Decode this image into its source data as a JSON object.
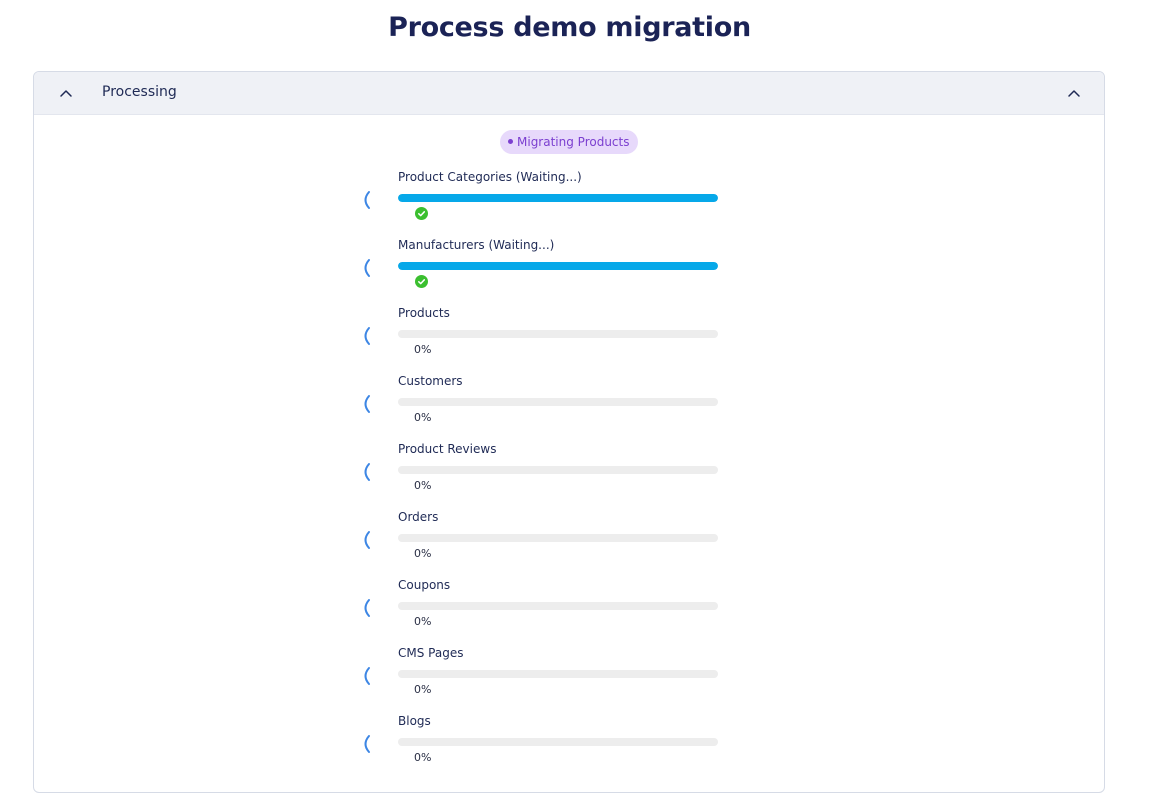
{
  "page": {
    "title": "Process demo migration"
  },
  "panel": {
    "title": "Processing",
    "status_badge": "Migrating Products"
  },
  "colors": {
    "progress_fill": "#06a8e9",
    "progress_track": "#ededed",
    "badge_bg": "#e7d9fb",
    "badge_text": "#7b3fd0",
    "success": "#3bbf2f",
    "spinner": "#3d86e4"
  },
  "steps": [
    {
      "label": "Product Categories (Waiting...)",
      "progress": 1.0,
      "status": "complete",
      "percent_text": ""
    },
    {
      "label": "Manufacturers (Waiting...)",
      "progress": 1.0,
      "status": "complete",
      "percent_text": ""
    },
    {
      "label": "Products",
      "progress": 0,
      "status": "pending",
      "percent_text": "0%"
    },
    {
      "label": "Customers",
      "progress": 0,
      "status": "pending",
      "percent_text": "0%"
    },
    {
      "label": "Product Reviews",
      "progress": 0,
      "status": "pending",
      "percent_text": "0%"
    },
    {
      "label": "Orders",
      "progress": 0,
      "status": "pending",
      "percent_text": "0%"
    },
    {
      "label": "Coupons",
      "progress": 0,
      "status": "pending",
      "percent_text": "0%"
    },
    {
      "label": "CMS Pages",
      "progress": 0,
      "status": "pending",
      "percent_text": "0%"
    },
    {
      "label": "Blogs",
      "progress": 0,
      "status": "pending",
      "percent_text": "0%"
    }
  ]
}
